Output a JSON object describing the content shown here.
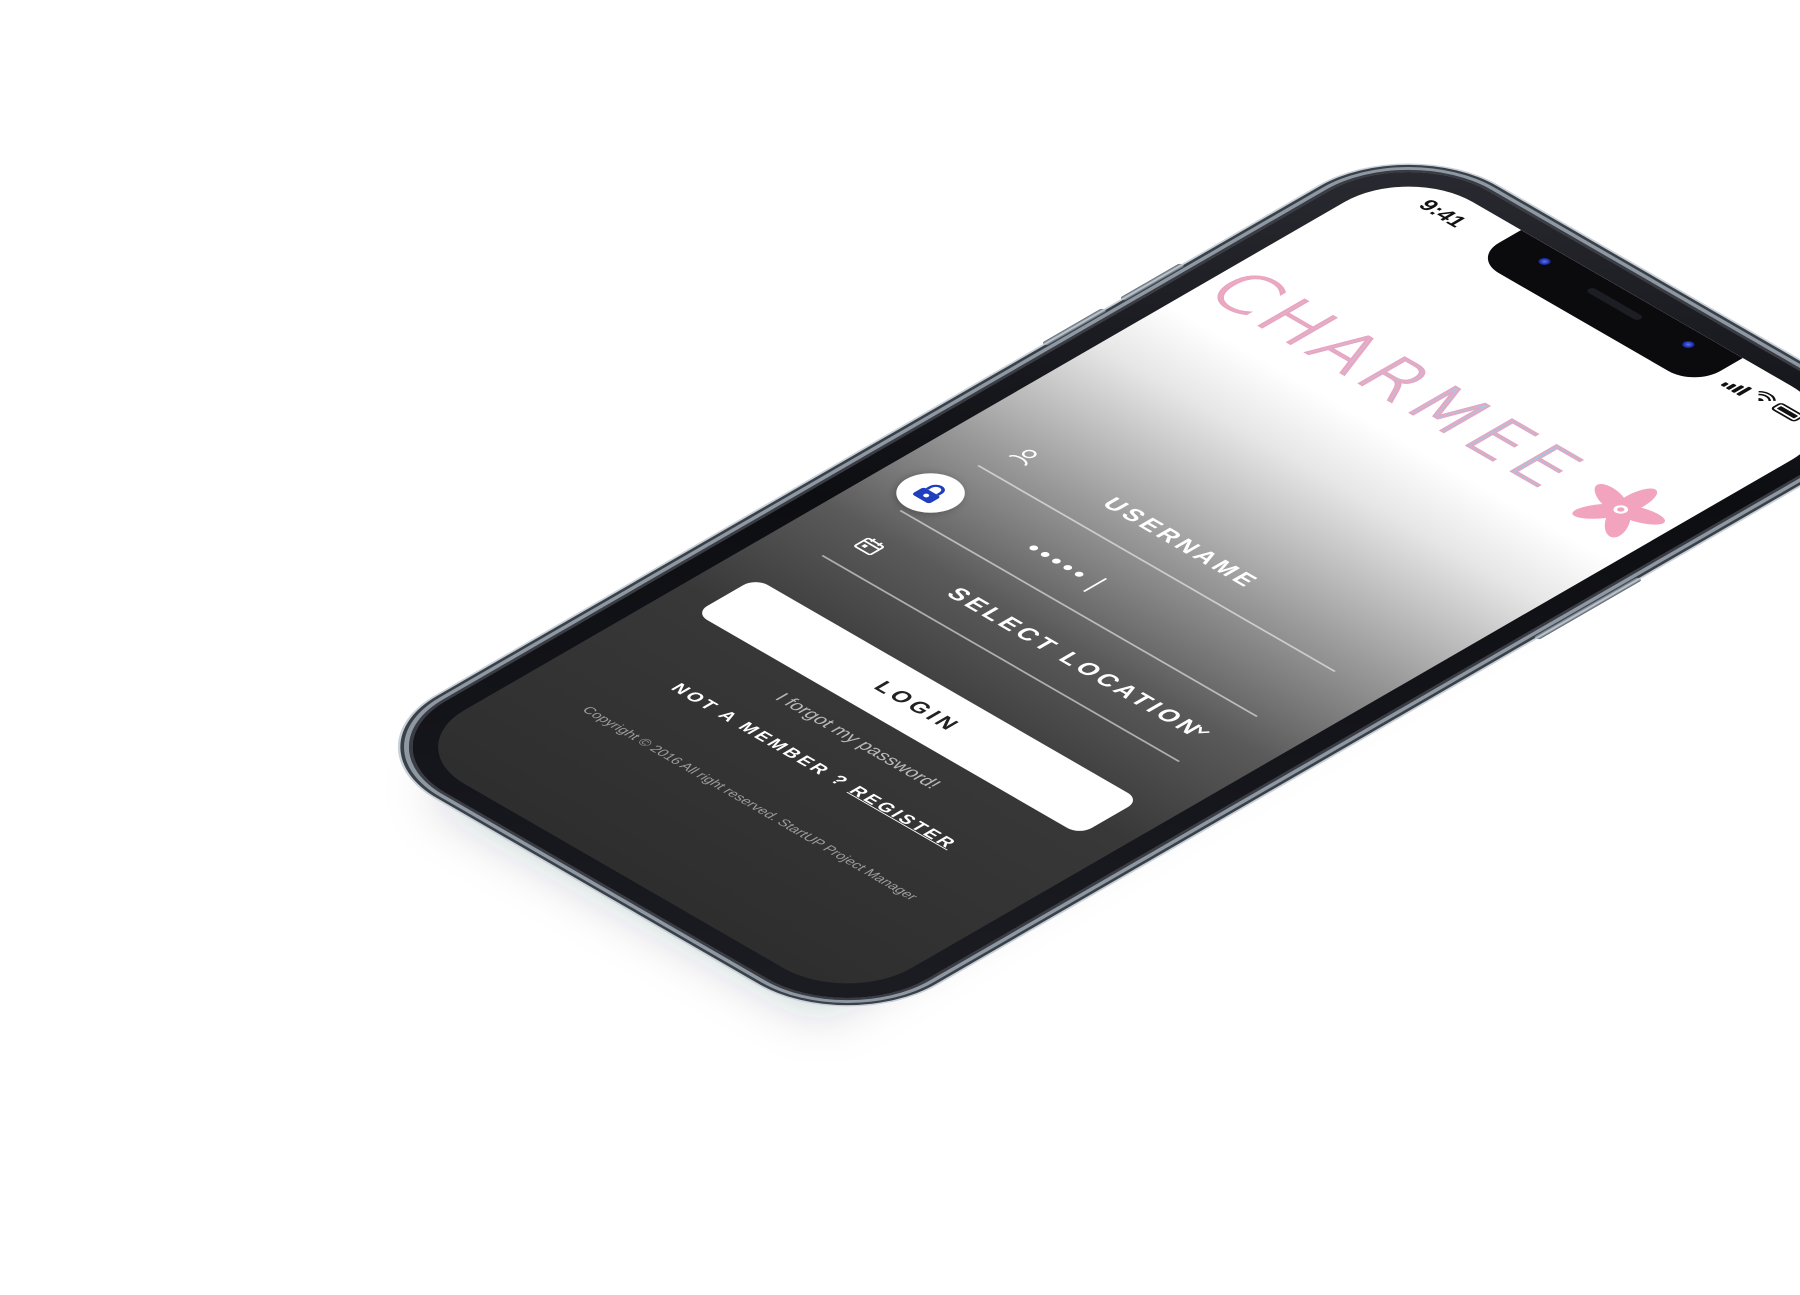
{
  "status_bar": {
    "time": "9:41"
  },
  "app": {
    "logo_text": "CHARMEE",
    "logo_icon": "flower-icon",
    "brand_colors": {
      "pink": "#f1a9c3",
      "blue": "#7fd3f0"
    }
  },
  "form": {
    "username_placeholder": "USERNAME",
    "password_value": "•••••",
    "location_placeholder": "SELECT LOCATION",
    "login_label": "LOGIN",
    "forgot_password": "I forgot my password!",
    "not_member": "NOT A MEMBER ?",
    "register_label": "REGISTER"
  },
  "footer": {
    "copyright": "Copyright © 2016 All right reserved. StartUP Project Manager"
  },
  "icons": {
    "username": "user-icon",
    "password": "lock-icon",
    "location": "calendar-icon",
    "dropdown": "chevron-down-icon"
  }
}
